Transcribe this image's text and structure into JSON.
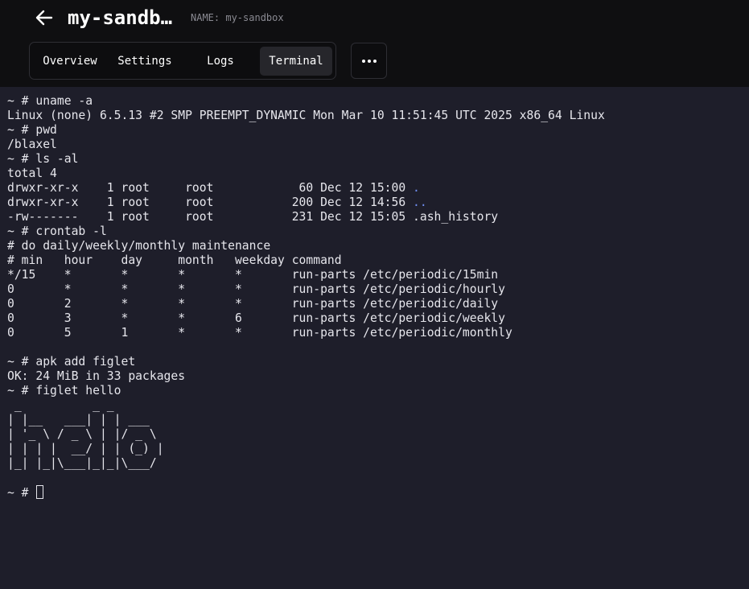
{
  "header": {
    "title": "my-sandb…",
    "name_label": "NAME: my-sandbox",
    "back_icon": "arrow-left-icon",
    "more_icon": "more-horizontal-icon"
  },
  "tabs": [
    {
      "label": "Overview"
    },
    {
      "label": "Settings"
    },
    {
      "label": "Logs"
    },
    {
      "label": "Terminal"
    }
  ],
  "terminal": {
    "lines": [
      "~ # uname -a",
      "Linux (none) 6.5.13 #2 SMP PREEMPT_DYNAMIC Mon Mar 10 11:51:45 UTC 2025 x86_64 Linux",
      "~ # pwd",
      "/blaxel",
      "~ # ls -al",
      "total 4",
      "drwxr-xr-x    1 root     root            60 Dec 12 15:00 ",
      "drwxr-xr-x    1 root     root           200 Dec 12 14:56 ",
      "-rw-------    1 root     root           231 Dec 12 15:05 .ash_history",
      "~ # crontab -l",
      "# do daily/weekly/monthly maintenance",
      "# min   hour    day     month   weekday command",
      "*/15    *       *       *       *       run-parts /etc/periodic/15min",
      "0       *       *       *       *       run-parts /etc/periodic/hourly",
      "0       2       *       *       *       run-parts /etc/periodic/daily",
      "0       3       *       *       6       run-parts /etc/periodic/weekly",
      "0       5       1       *       *       run-parts /etc/periodic/monthly",
      "",
      "~ # apk add figlet",
      "OK: 24 MiB in 33 packages",
      "~ # figlet hello",
      " _          _ _       ",
      "| |__   ___| | | ___  ",
      "| '_ \\ / _ \\ | |/ _ \\ ",
      "| | | |  __/ | | (_) |",
      "|_| |_|\\___|_|_|\\___/ ",
      "",
      "~ # "
    ],
    "dir_entries": {
      "6": ".",
      "7": ".."
    },
    "dir_color": "#6f8df0"
  }
}
